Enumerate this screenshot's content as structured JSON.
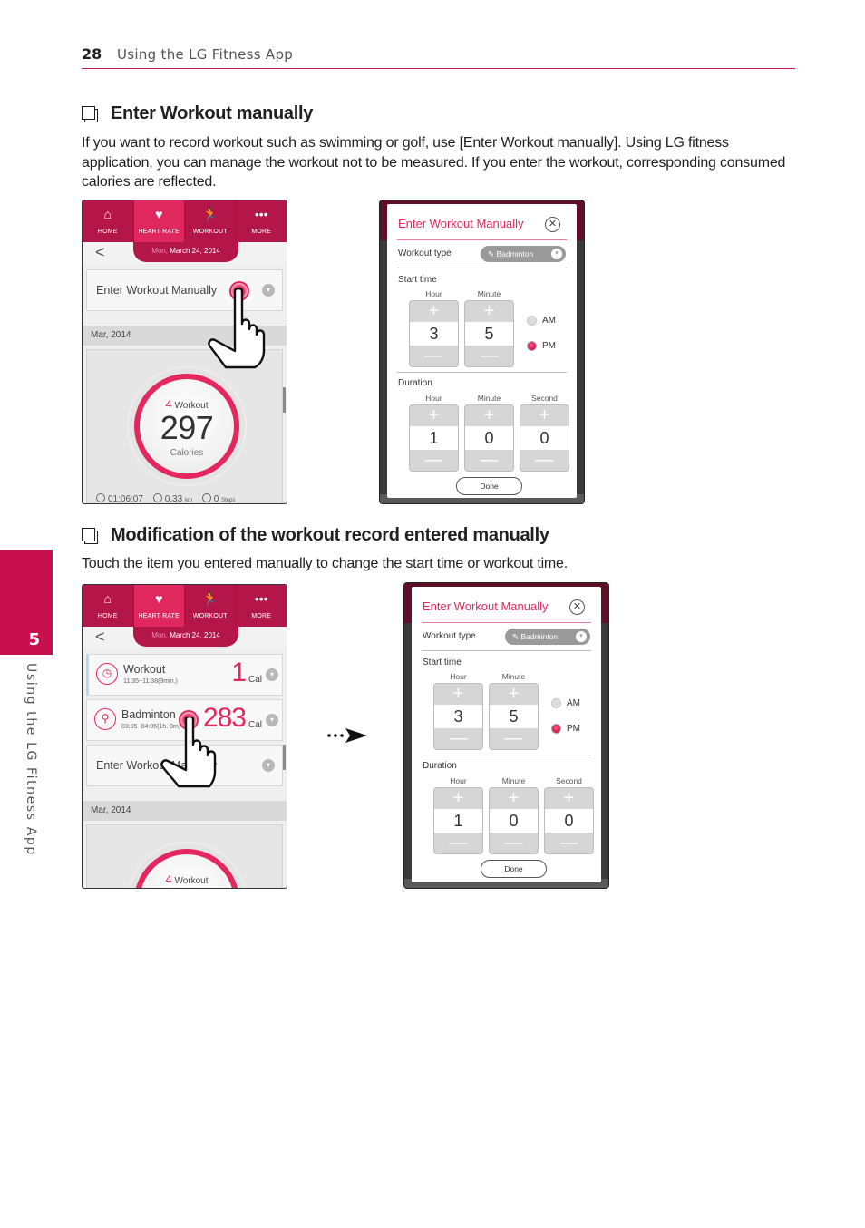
{
  "header": {
    "page_number": "28",
    "section": "Using the LG Fitness App"
  },
  "side_tab": {
    "chapter_number": "5",
    "label": "Using the LG Fitness App"
  },
  "section1": {
    "icon": "note-pages-icon",
    "title": "Enter Workout manually",
    "body": "If you want to record workout such as swimming or golf, use [Enter Workout manually]. Using LG fitness application, you can manage the workout not to be measured. If you enter the workout, corresponding consumed calories are reflected."
  },
  "section2": {
    "icon": "note-pages-icon",
    "title": "Modification of the workout record entered manually",
    "body": "Touch the item you entered manually to change the start time or workout time."
  },
  "app": {
    "tabs": [
      {
        "label": "HOME",
        "icon": "home-icon",
        "glyph": "⌂"
      },
      {
        "label": "HEART RATE",
        "icon": "heart-rate-icon",
        "glyph": "♥"
      },
      {
        "label": "WORKOUT",
        "icon": "runner-icon",
        "glyph": "🏃"
      },
      {
        "label": "MORE",
        "icon": "more-icon",
        "glyph": "•••"
      }
    ],
    "active_tab": "HEART RATE",
    "back_glyph": "<",
    "date_day": "Mon,",
    "date_rest": " March 24, 2014",
    "enter_manual_label": "Enter Workout Manually",
    "month_label": "Mar, 2014",
    "summary": {
      "workout_count": "4",
      "workout_label": "Workout",
      "calories": "297",
      "calories_label": "Calories",
      "duration": "01:06:07",
      "distance": "0.33",
      "distance_unit": "km",
      "steps": "0",
      "steps_unit": "Steps"
    },
    "records": [
      {
        "name": "Workout",
        "time": "11:35~11:38(3min.)",
        "value": "1",
        "unit": "Cal",
        "icon": "clock-icon",
        "glyph": "◷"
      },
      {
        "name": "Badminton",
        "time": "03:05~04:05(1h. 0m)",
        "value": "283",
        "unit": "Cal",
        "icon": "shuttlecock-icon",
        "glyph": "⚲"
      }
    ]
  },
  "dialog": {
    "title": "Enter Workout Manually",
    "close_glyph": "✕",
    "workout_type_label": "Workout type",
    "workout_type_value": "Badminton",
    "start_time_label": "Start time",
    "start": {
      "hour_label": "Hour",
      "minute_label": "Minute",
      "hour": "3",
      "minute": "5",
      "am_label": "AM",
      "pm_label": "PM",
      "selected": "PM"
    },
    "duration_label": "Duration",
    "duration": {
      "hour_label": "Hour",
      "minute_label": "Minute",
      "second_label": "Second",
      "hour": "1",
      "minute": "0",
      "second": "0"
    },
    "plus": "+",
    "minus": "—",
    "done_label": "Done"
  },
  "colors": {
    "brand": "#c8104e",
    "accent_pink": "#e4285f",
    "tabbar": "#b5164a"
  }
}
